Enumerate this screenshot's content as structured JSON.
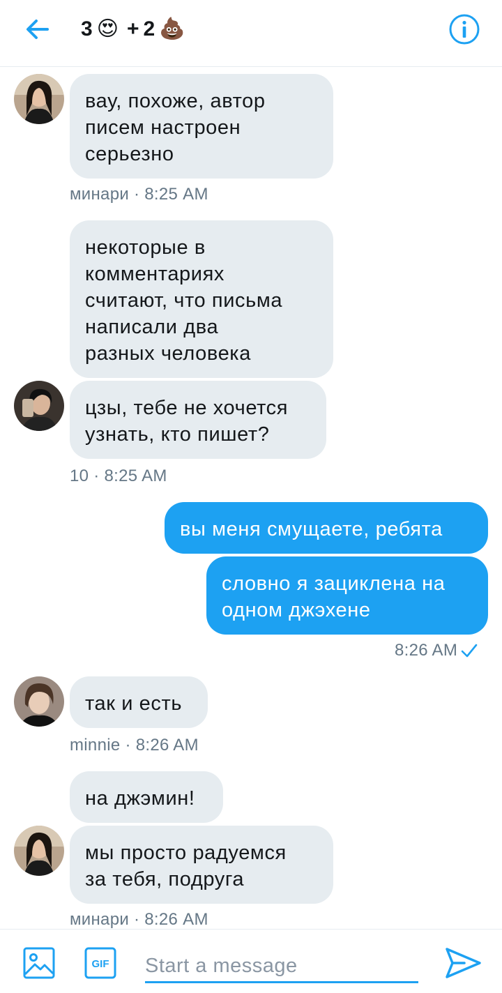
{
  "header": {
    "title_count_a": "3",
    "title_emoji_a": "😍",
    "title_plus": "+",
    "title_count_b": "2",
    "title_emoji_b": "💩"
  },
  "messages": [
    {
      "text_lines": [
        "вау, похоже, автор",
        "писем настроен",
        "серьезно"
      ],
      "meta": "минари · 8:25 AM"
    },
    {
      "text_lines": [
        "некоторые в",
        "комментариях",
        "считают, что письма",
        "написали два",
        "разных человека"
      ]
    },
    {
      "text_lines": [
        "цзы, тебе не хочется",
        "узнать, кто пишет?"
      ],
      "meta": "10 · 8:25 AM"
    },
    {
      "text": "вы меня смущаете, ребята"
    },
    {
      "text_lines": [
        "словно я зациклена на",
        "одном джэхене"
      ],
      "meta": "8:26 AM"
    },
    {
      "text": "так и есть",
      "meta": "minnie · 8:26 AM"
    },
    {
      "text": "на джэмин!"
    },
    {
      "text_lines": [
        "мы просто радуемся",
        "за тебя, подруга"
      ],
      "meta": "минари · 8:26 AM"
    }
  ],
  "composer": {
    "placeholder": "Start a message",
    "gif_label": "GIF"
  },
  "colors": {
    "accent": "#1da1f2",
    "incoming_bubble": "#e6ecf0",
    "meta_text": "#657786"
  },
  "icons": [
    "back-arrow-icon",
    "info-icon",
    "image-icon",
    "gif-icon",
    "send-icon",
    "checkmark-icon"
  ]
}
